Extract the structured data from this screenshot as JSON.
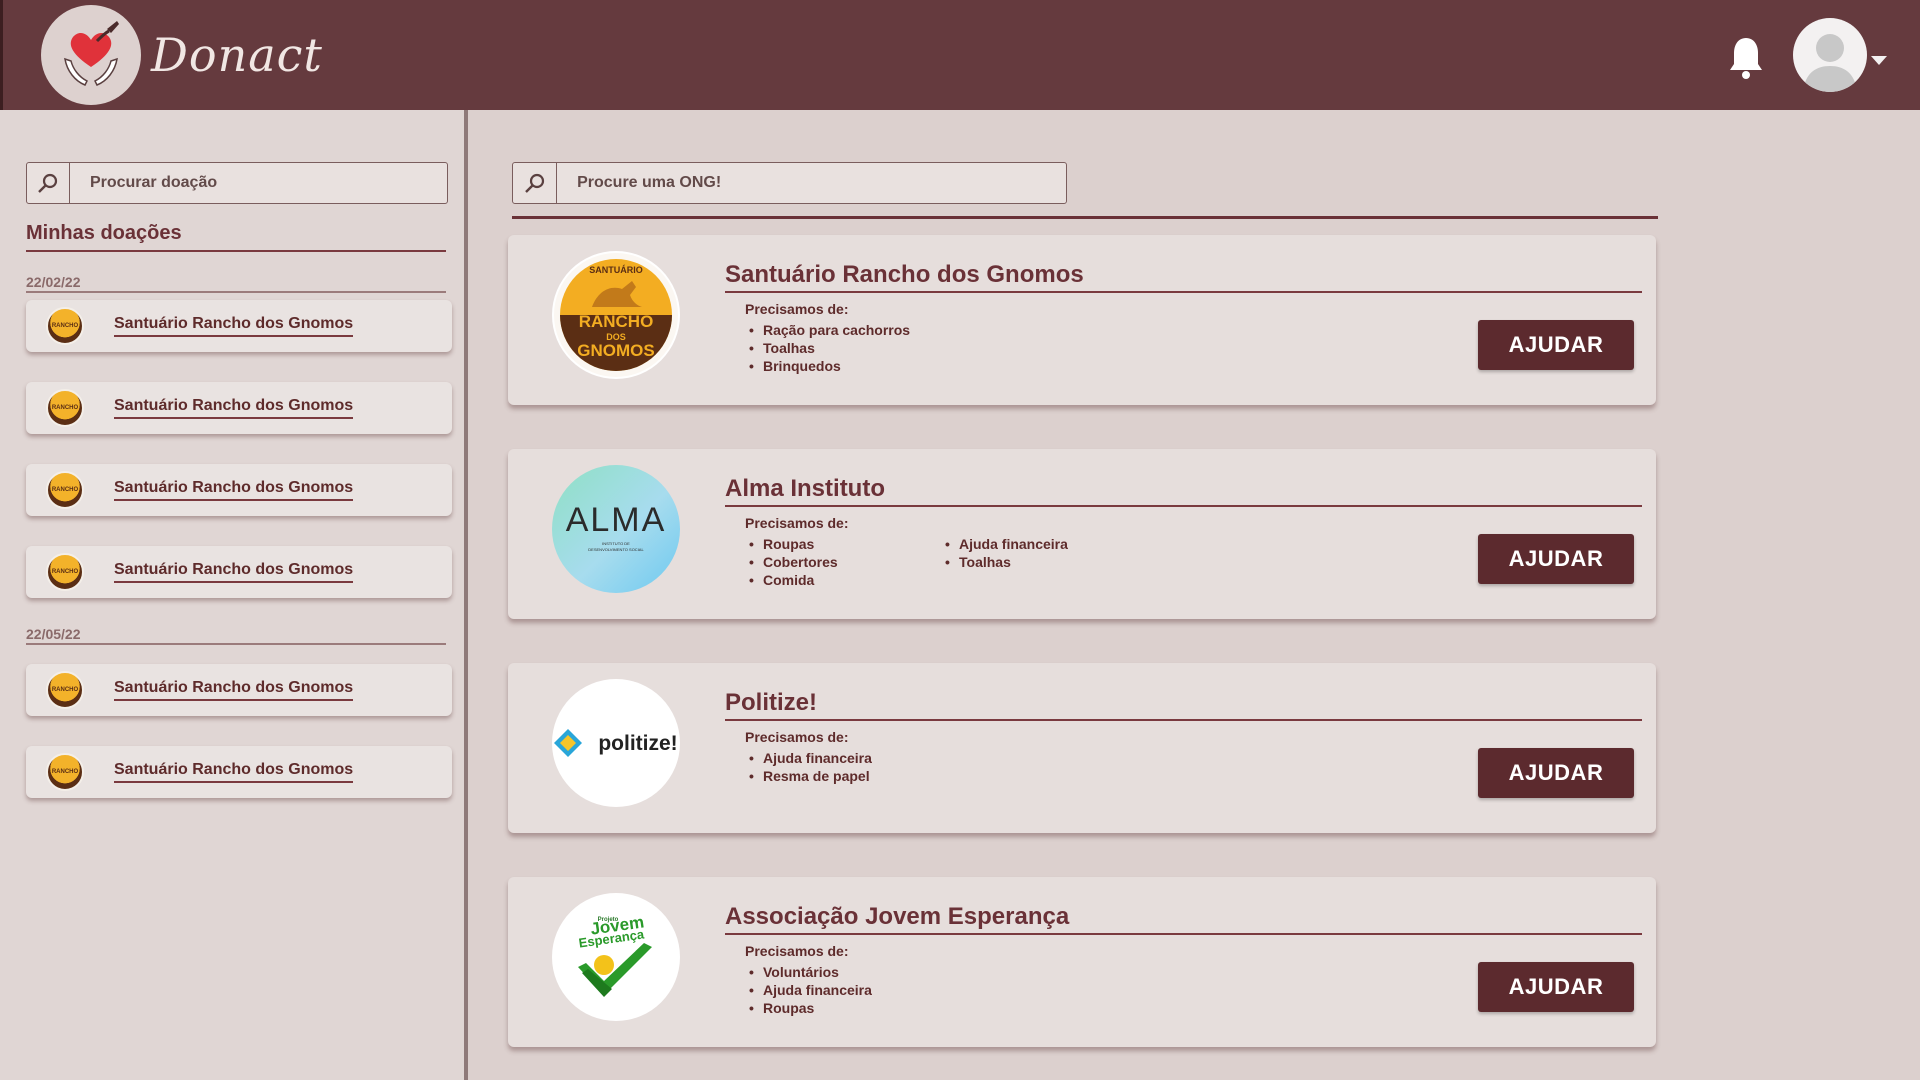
{
  "app": {
    "name": "Donact"
  },
  "sidebar": {
    "search_placeholder": "Procurar doação",
    "title": "Minhas doações",
    "groups": [
      {
        "date": "22/02/22",
        "items": [
          "Santuário Rancho dos Gnomos",
          "Santuário Rancho dos Gnomos",
          "Santuário Rancho dos Gnomos",
          "Santuário Rancho dos Gnomos"
        ]
      },
      {
        "date": "22/05/22",
        "items": [
          "Santuário Rancho dos Gnomos",
          "Santuário Rancho dos Gnomos"
        ]
      }
    ]
  },
  "main": {
    "search_placeholder": "Procure uma ONG!",
    "needs_title": "Precisamos de:",
    "help_label": "AJUDAR",
    "orgs": [
      {
        "name": "Santuário Rancho dos Gnomos",
        "needs": [
          "Ração para cachorros",
          "Toalhas",
          "Brinquedos"
        ],
        "needs_col2": []
      },
      {
        "name": "Alma Instituto",
        "needs": [
          "Roupas",
          "Cobertores",
          "Comida"
        ],
        "needs_col2": [
          "Ajuda financeira",
          "Toalhas"
        ]
      },
      {
        "name": "Politize!",
        "needs": [
          "Ajuda financeira",
          "Resma de papel"
        ],
        "needs_col2": []
      },
      {
        "name": "Associação Jovem Esperança",
        "needs": [
          "Voluntários",
          "Ajuda financeira",
          "Roupas"
        ],
        "needs_col2": []
      }
    ],
    "logo_text": {
      "rancho": [
        "SANTUÁRIO",
        "RANCHO",
        "DOS",
        "GNOMOS"
      ],
      "alma": [
        "ALMA",
        "INSTITUTO DE",
        "DESENVOLVIMENTO SOCIAL"
      ],
      "politize": "politize!",
      "jovem": [
        "Projeto",
        "Jovem",
        "Esperança"
      ]
    }
  },
  "colors": {
    "header": "#653a3e",
    "accent": "#5c2a2e",
    "background": "#dcd0ce"
  },
  "icons": {
    "notification": "bell-icon",
    "user": "user-avatar-icon",
    "search": "search-icon"
  }
}
